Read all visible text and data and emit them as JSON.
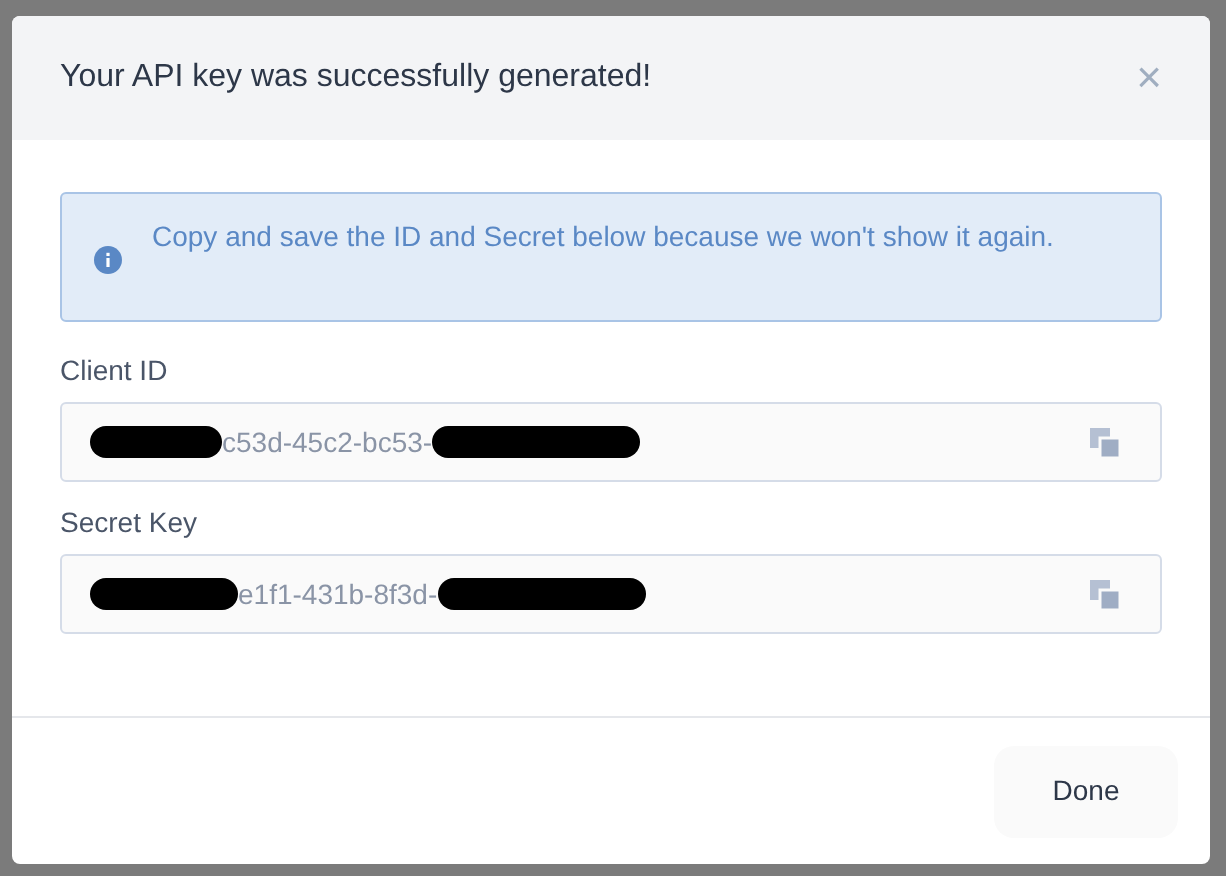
{
  "dialog": {
    "title": "Your API key was successfully generated!",
    "close": "×",
    "notice": "Copy and save the ID and Secret below because we won't show it again.",
    "fields": [
      {
        "label": "Client ID",
        "value": "c53d-45c2-bc53-"
      },
      {
        "label": "Secret Key",
        "value": "e1f1-431b-8f3d-"
      }
    ],
    "button": "Done"
  }
}
